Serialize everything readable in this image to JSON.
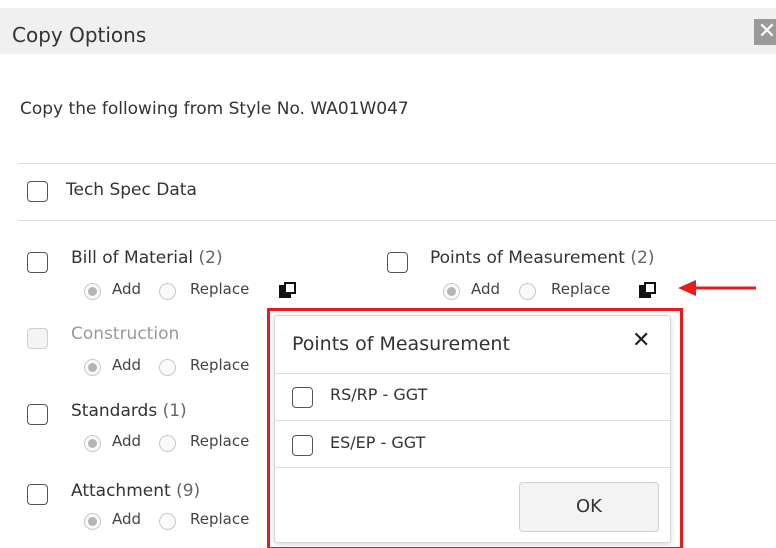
{
  "dialog": {
    "title": "Copy Options",
    "close_glyph": "✕"
  },
  "intro": "Copy the following from Style No. WA01W047",
  "items": {
    "tech_spec": {
      "label": "Tech Spec Data"
    },
    "bom": {
      "label": "Bill of Material",
      "count": "(2)"
    },
    "pom": {
      "label": "Points of Measurement",
      "count": "(2)"
    },
    "construction": {
      "label": "Construction"
    },
    "standards": {
      "label": "Standards",
      "count": "(1)"
    },
    "attachment": {
      "label": "Attachment",
      "count": "(9)"
    }
  },
  "radio": {
    "add": "Add",
    "replace": "Replace"
  },
  "popup": {
    "title": "Points of Measurement",
    "close_glyph": "✕",
    "options": [
      "RS/RP - GGT",
      "ES/EP - GGT"
    ],
    "ok": "OK"
  },
  "colors": {
    "highlight": "#e41e1e",
    "titlebar": "#f0f0f0"
  },
  "icons": [
    "close-icon",
    "copy-icon",
    "arrow-left-icon"
  ]
}
